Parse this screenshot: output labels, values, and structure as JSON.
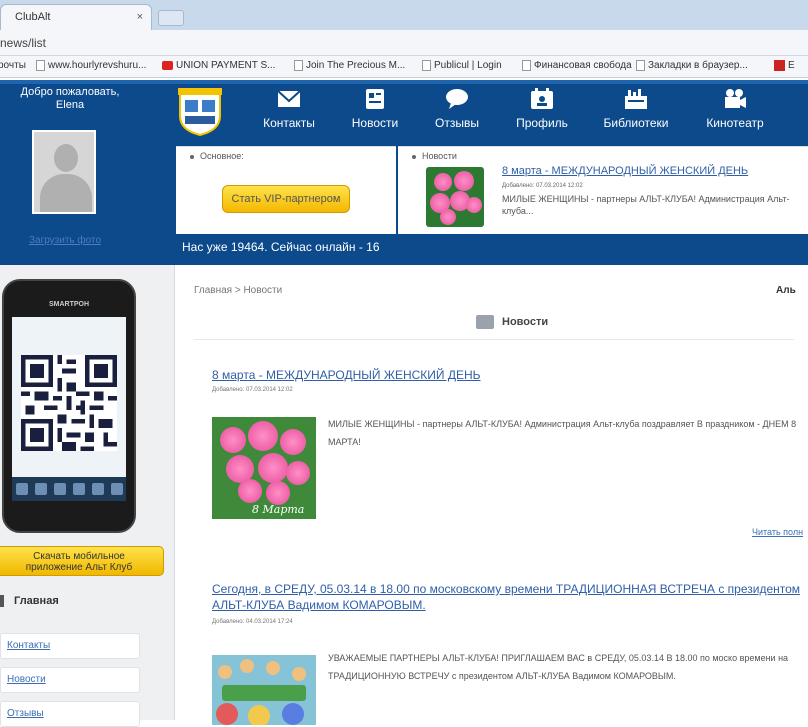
{
  "browser": {
    "tab_title": "ClubAlt",
    "tab_close": "×",
    "url": "news/list",
    "bookmarks": [
      {
        "label": "рочты",
        "icon": "page-icon"
      },
      {
        "label": "www.hourlyrevshuru...",
        "icon": "page-icon"
      },
      {
        "label": "UNION PAYMENT S...",
        "icon": "youtube-icon"
      },
      {
        "label": "Join The Precious M...",
        "icon": "page-icon"
      },
      {
        "label": "Publicul | Login",
        "icon": "page-icon"
      },
      {
        "label": "Финансовая свобода",
        "icon": "page-icon"
      },
      {
        "label": "Закладки в браузер...",
        "icon": "page-icon"
      },
      {
        "label": "E",
        "icon": "ebay-icon"
      }
    ]
  },
  "header": {
    "welcome_line1": "Добро пожаловать,",
    "welcome_user": "Elena",
    "change_photo": "Загрузить фото",
    "nav": [
      {
        "label": "Контакты",
        "icon": "mail-icon"
      },
      {
        "label": "Новости",
        "icon": "news-icon"
      },
      {
        "label": "Отзывы",
        "icon": "chat-icon"
      },
      {
        "label": "Профиль",
        "icon": "profile-icon"
      },
      {
        "label": "Библиотеки",
        "icon": "library-icon"
      },
      {
        "label": "Кинотеатр",
        "icon": "camera-icon"
      }
    ],
    "main_panel_label": "Основное:",
    "vip_button": "Стать VIP-партнером",
    "news_panel_label": "Новости",
    "news_title": "8 марта - МЕЖДУНАРОДНЫЙ ЖЕНСКИЙ ДЕНЬ",
    "news_meta": "Добавлено: 07.03.2014 12:02",
    "news_excerpt": "МИЛЫЕ ЖЕНЩИНЫ - партнеры АЛЬТ-КЛУБА! Администрация Альт-клуба...",
    "stats": "Нас уже 19464. Сейчас онлайн - 16"
  },
  "sidebar": {
    "phone_brand": "SMARTPOH",
    "download_line1": "Скачать мобильное",
    "download_line2": "приложение Альт Клуб",
    "menu_title": "Главная",
    "menu_items": [
      "Контакты",
      "Новости",
      "Отзывы"
    ]
  },
  "main": {
    "breadcrumb": "Главная > Новости",
    "right_cut": "Аль",
    "section_title": "Новости",
    "articles": [
      {
        "title": "8 марта - МЕЖДУНАРОДНЫЙ ЖЕНСКИЙ ДЕНЬ",
        "meta": "Добавлено: 07.03.2014 12:02",
        "text": "МИЛЫЕ ЖЕНЩИНЫ - партнеры АЛЬТ-КЛУБА! Администрация Альт-клуба поздравляет В праздником - ДНЕМ 8 МАРТА!",
        "image_caption": "8 Марта"
      },
      {
        "title": "Сегодня, в СРЕДУ, 05.03.14 в 18.00 по московскому времени ТРАДИЦИОННАЯ ВСТРЕЧА с президентом АЛЬТ-КЛУБА Вадимом КОМАРОВЫМ.",
        "meta": "Добавлено: 04.03.2014 17:24",
        "text": "УВАЖАЕМЫЕ ПАРТНЕРЫ АЛЬТ-КЛУБА! ПРИГЛАШАЕМ ВАС в СРЕДУ, 05.03.14 В 18.00 по моско времени на ТРАДИЦИОННУЮ ВСТРЕЧУ с президентом АЛЬТ-КЛУБА Вадимом КОМАРОВЫМ."
      }
    ],
    "read_more": "Читать полн"
  }
}
